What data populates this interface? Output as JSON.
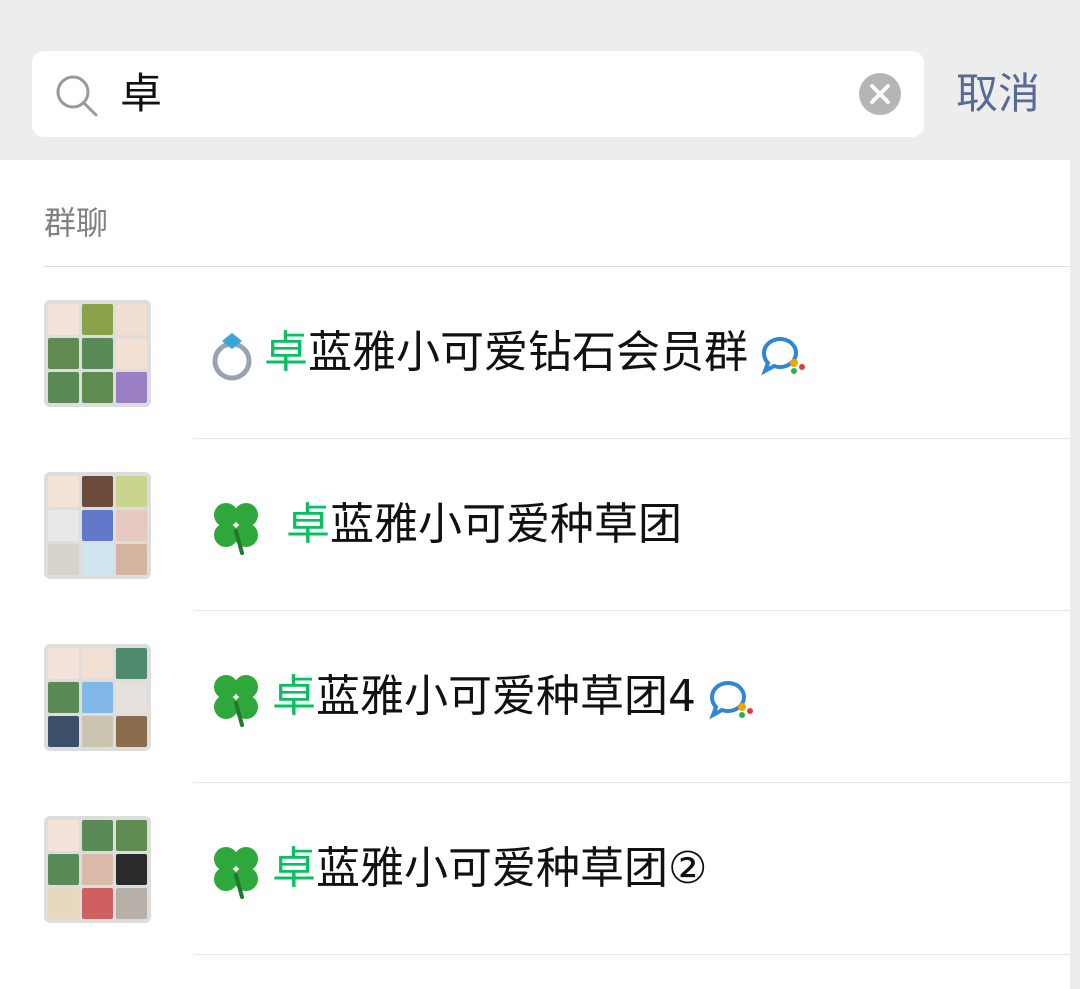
{
  "search": {
    "query": "卓",
    "cancel_label": "取消"
  },
  "section": {
    "title": "群聊"
  },
  "results": [
    {
      "emoji": "ring",
      "highlight": "卓",
      "rest": "蓝雅小可爱钻石会员群",
      "badge": "enterprise-chat-icon"
    },
    {
      "emoji": "clover",
      "highlight": "卓",
      "rest": "蓝雅小可爱种草团",
      "badge": ""
    },
    {
      "emoji": "clover",
      "highlight": "卓",
      "rest": "蓝雅小可爱种草团4",
      "badge": "enterprise-chat-icon"
    },
    {
      "emoji": "clover",
      "highlight": "卓",
      "rest": "蓝雅小可爱种草团②",
      "badge": ""
    }
  ],
  "colors": {
    "highlight": "#07c160",
    "cancel": "#576b95",
    "background": "#ededed"
  }
}
